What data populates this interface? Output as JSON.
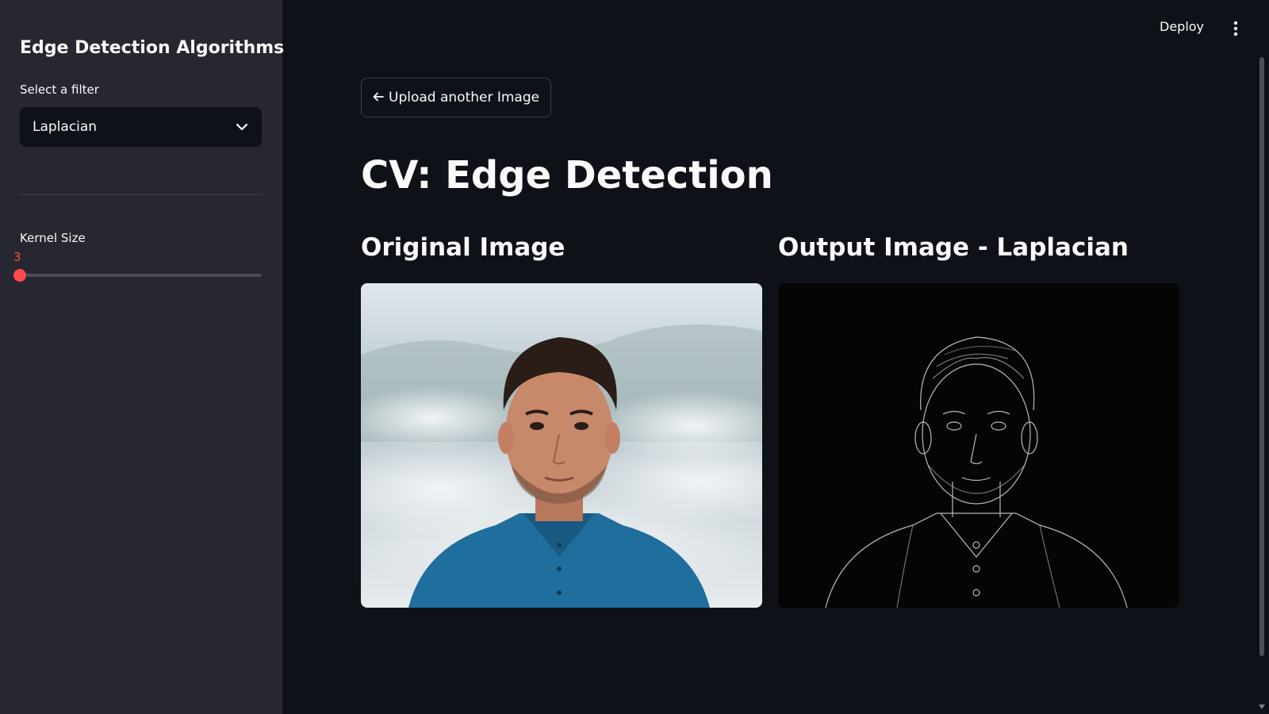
{
  "sidebar": {
    "title": "Edge Detection Algorithms",
    "filter": {
      "label": "Select a filter",
      "selected": "Laplacian"
    },
    "kernel": {
      "label": "Kernel Size",
      "value": "3",
      "position_fraction": 0.0
    }
  },
  "header": {
    "deploy_label": "Deploy",
    "menu_icon": "three-dots-vertical-icon"
  },
  "main": {
    "upload_label": "Upload another Image",
    "upload_icon": "arrow-left-icon",
    "title": "CV: Edge Detection",
    "original_heading": "Original Image",
    "output_heading": "Output Image - Laplacian"
  },
  "colors": {
    "background": "#0e1117",
    "sidebar": "#262730",
    "accent": "#ff4b4b",
    "text": "#fafafa"
  }
}
